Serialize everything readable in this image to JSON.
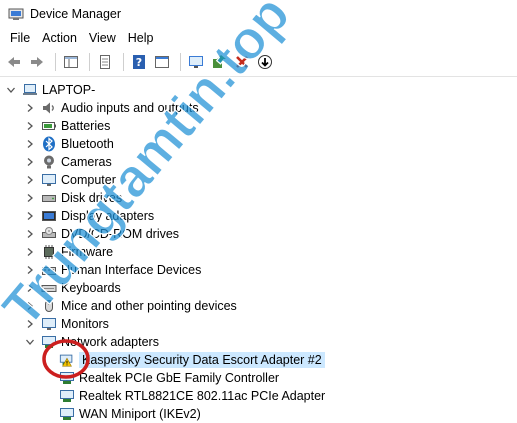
{
  "window": {
    "title": "Device Manager"
  },
  "menu": [
    "File",
    "Action",
    "View",
    "Help"
  ],
  "watermark": "Trungtamtin.top",
  "tree": {
    "root": "LAPTOP-",
    "categories": [
      {
        "label": "Audio inputs and outputs",
        "icon": "speaker-icon"
      },
      {
        "label": "Batteries",
        "icon": "battery-icon"
      },
      {
        "label": "Bluetooth",
        "icon": "bluetooth-icon"
      },
      {
        "label": "Cameras",
        "icon": "camera-icon"
      },
      {
        "label": "Computer",
        "icon": "computer-icon"
      },
      {
        "label": "Disk drives",
        "icon": "disk-drive-icon"
      },
      {
        "label": "Display adapters",
        "icon": "display-adapter-icon"
      },
      {
        "label": "DVD/CD-ROM drives",
        "icon": "dvd-drive-icon"
      },
      {
        "label": "Firmware",
        "icon": "firmware-icon"
      },
      {
        "label": "Human Interface Devices",
        "icon": "hid-icon"
      },
      {
        "label": "Keyboards",
        "icon": "keyboard-icon"
      },
      {
        "label": "Mice and other pointing devices",
        "icon": "mouse-icon"
      },
      {
        "label": "Monitors",
        "icon": "monitor-icon"
      }
    ],
    "expanded": {
      "label": "Network adapters",
      "children": [
        {
          "label": "Kaspersky Security Data Escort Adapter #2",
          "warning": true
        },
        {
          "label": "Realtek PCIe GbE Family Controller",
          "warning": false
        },
        {
          "label": "Realtek RTL8821CE 802.11ac PCIe Adapter",
          "warning": false
        },
        {
          "label": "WAN Miniport (IKEv2)",
          "warning": false
        }
      ]
    }
  },
  "colors": {
    "selection": "#cce8ff",
    "accent": "#0078d7",
    "error_red": "#c42b1c",
    "annotation_circle": "#cc1f1f",
    "watermark": "#1e90d6"
  }
}
